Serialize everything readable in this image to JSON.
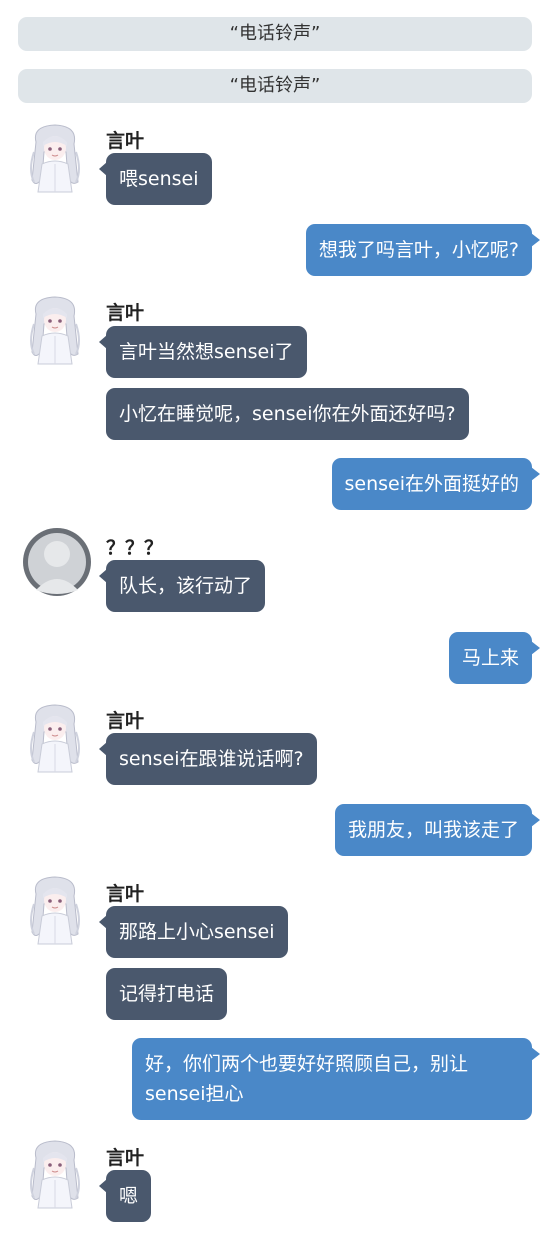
{
  "system_messages": [
    "“电话铃声”",
    "“电话铃声”"
  ],
  "speakers": {
    "kotoha": "言叶",
    "unknown": "？？？"
  },
  "messages": [
    {
      "side": "left",
      "text": "喂sensei"
    },
    {
      "side": "right",
      "text": "想我了吗言叶，小忆呢?"
    },
    {
      "side": "left",
      "text": "言叶当然想sensei了"
    },
    {
      "side": "left",
      "text": "小忆在睡觉呢，sensei你在外面还好吗?"
    },
    {
      "side": "right",
      "text": "sensei在外面挺好的"
    },
    {
      "side": "left",
      "text": "队长，该行动了"
    },
    {
      "side": "right",
      "text": "马上来"
    },
    {
      "side": "left",
      "text": "sensei在跟谁说话啊?"
    },
    {
      "side": "right",
      "text": "我朋友，叫我该走了"
    },
    {
      "side": "left",
      "text": "那路上小心sensei"
    },
    {
      "side": "left",
      "text": "记得打电话"
    },
    {
      "side": "right",
      "text": "好，你们两个也要好好照顾自己，别让sensei担心"
    },
    {
      "side": "left",
      "text": "嗯"
    }
  ],
  "colors": {
    "left_bubble": "#4a586d",
    "right_bubble": "#4a88c8",
    "system_bg": "#dfe5e9"
  }
}
